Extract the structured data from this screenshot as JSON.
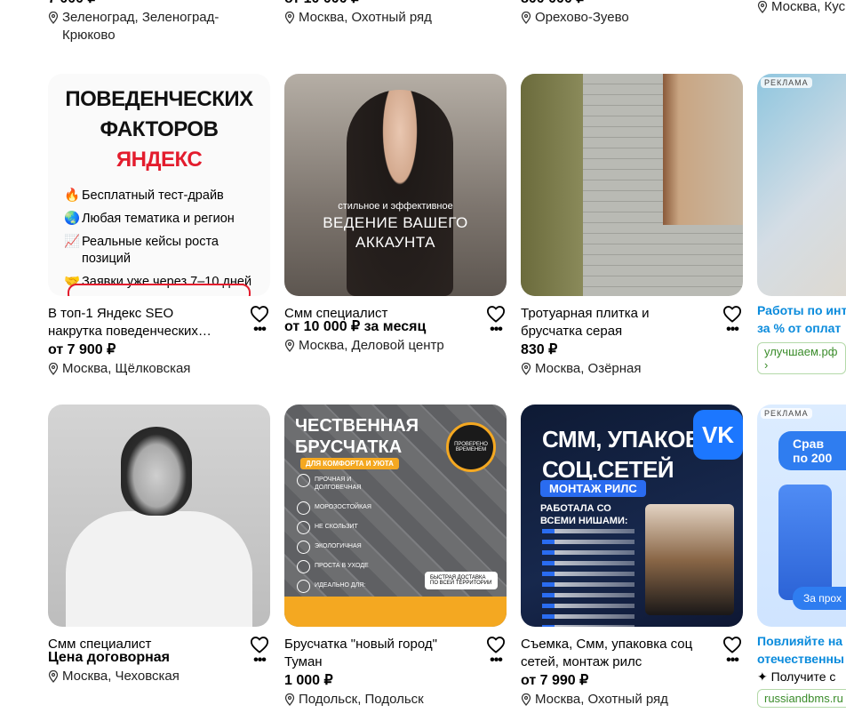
{
  "top_row": [
    {
      "price": "7 000 ₽",
      "location": "Зеленоград, Зеленоград-Крюково"
    },
    {
      "price": "от 10 000 ₽",
      "location": "Москва, Охотный ряд"
    },
    {
      "price": "800 000 ₽",
      "location": "Орехово-Зуево"
    },
    {
      "location": "Москва, Кус"
    }
  ],
  "row2": [
    {
      "title": "В топ-1 Яндекс SEO накрутка поведенческих…",
      "price": "от 7 900 ₽",
      "location": "Москва, Щёлковская",
      "image": {
        "headline_1": "ПОВЕДЕНЧЕСКИХ",
        "headline_2a": "ФАКТОРОВ ",
        "headline_2b": "ЯНДЕКС",
        "bullets": [
          {
            "icon": "🔥",
            "text": "Бесплатный тест-драйв"
          },
          {
            "icon": "🌏",
            "text": "Любая тематика и регион"
          },
          {
            "icon": "📈",
            "text": "Реальные кейсы роста позиций"
          },
          {
            "icon": "🤝",
            "text": "Заявки уже через 7–10 дней"
          }
        ]
      }
    },
    {
      "title": "Смм специалист",
      "price": "от 10 000 ₽ за месяц",
      "location": "Москва, Деловой центр",
      "image": {
        "line1": "стильное и эффективное",
        "line2": "ВЕДЕНИЕ ВАШЕГО",
        "line3": "АККАУНТА"
      }
    },
    {
      "title": "Тротуарная плитка и брусчатка серая",
      "price": "830 ₽",
      "location": "Москва, Озёрная"
    },
    {
      "badge": "РЕКЛАМА",
      "title_1": "Работы по инт",
      "title_2": "за % от оплат",
      "domain": "улучшаем.рф ›"
    }
  ],
  "row3": [
    {
      "title": "Смм специалист",
      "price": "Цена договорная",
      "location": "Москва, Чеховская"
    },
    {
      "title": "Брусчатка \"новый город\" Туман",
      "price": "1 000 ₽",
      "location": "Подольск, Подольск",
      "image": {
        "head_1": "ЧЕСТВЕННАЯ",
        "head_2": "БРУСЧАТКА",
        "tag": "ДЛЯ КОМФОРТА И УЮТА",
        "features": [
          "ПРОЧНАЯ И ДОЛГОВЕЧНАЯ",
          "МОРОЗОСТОЙКАЯ",
          "НЕ СКОЛЬЗИТ",
          "ЭКОЛОГИЧНАЯ",
          "ПРОСТА В УХОДЕ",
          "ИДЕАЛЬНО ДЛЯ:"
        ],
        "badge": "ПРОВЕРЕНО ВРЕМЕНЕМ",
        "delivery": "БЫСТРАЯ ДОСТАВКА ПО ВСЕЙ ТЕРРИТОРИИ"
      }
    },
    {
      "title": "Съемка, Смм, упаковка соц сетей, монтаж рилс",
      "price": "от 7 990 ₽",
      "location": "Москва, Охотный ряд",
      "image": {
        "head_1": "СММ, УПАКОВКА",
        "head_2": "СОЦ.СЕТЕЙ",
        "tag": "МОНТАЖ РИЛС",
        "sub_1": "РАБОТАЛА СО",
        "sub_2": "ВСЕМИ НИШАМИ:",
        "vk": "VK"
      }
    },
    {
      "badge": "РЕКЛАМА",
      "title_1": "Повлияйте на",
      "title_2": "отечественны",
      "extra": "Получите с",
      "domain": "russiandbms.ru",
      "image": {
        "pill_1": "Срав",
        "pill_2": "по 200",
        "button": "За прох"
      }
    }
  ]
}
